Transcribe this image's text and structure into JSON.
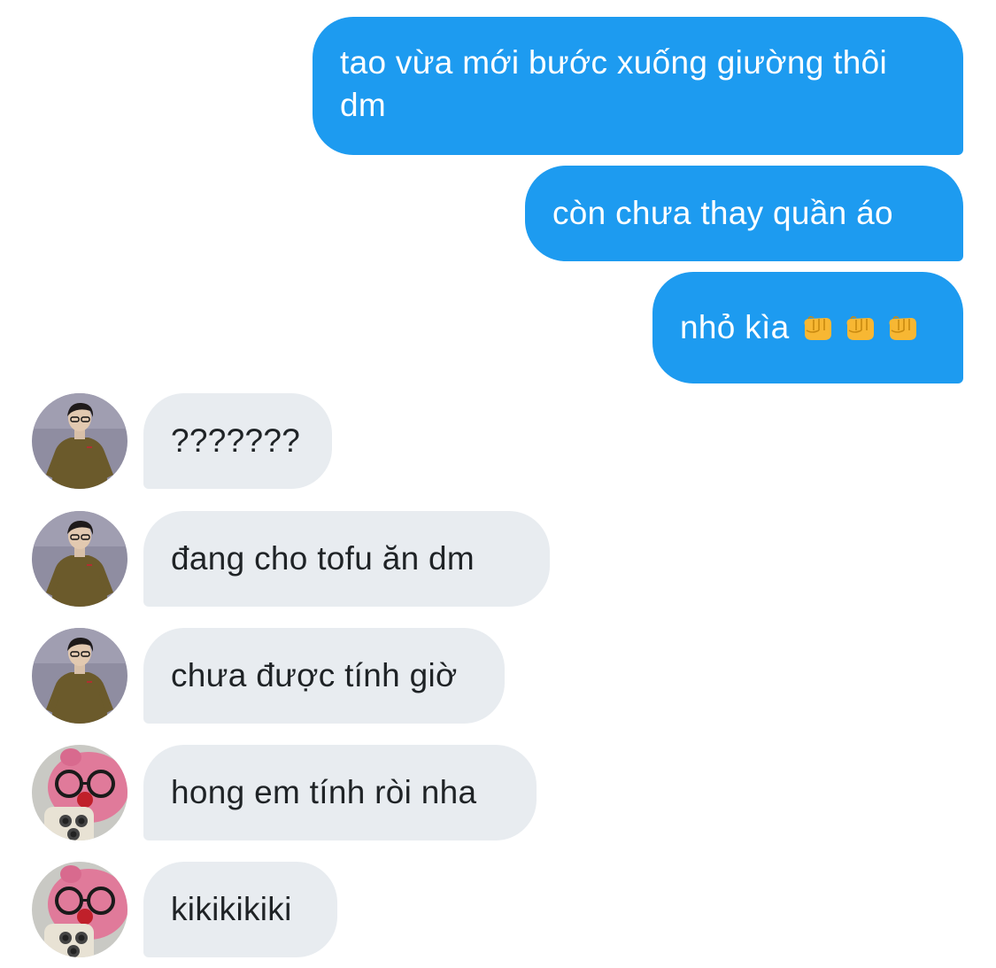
{
  "messages": {
    "sent": [
      {
        "text": "tao vừa mới bước xuống giường thôi dm"
      },
      {
        "text": "còn chưa thay quần áo"
      },
      {
        "text": "nhỏ kìa",
        "emoji": [
          "oncoming-fist-icon",
          "oncoming-fist-icon",
          "oncoming-fist-icon"
        ]
      }
    ],
    "received": [
      {
        "text": "???????",
        "avatar": "person-olive-shirt"
      },
      {
        "text": "đang cho tofu ăn dm",
        "avatar": "person-olive-shirt"
      },
      {
        "text": "chưa được tính giờ",
        "avatar": "person-olive-shirt"
      },
      {
        "text": "hong em tính ròi nha",
        "avatar": "pink-plush-with-glasses"
      },
      {
        "text": "kikikikiki",
        "avatar": "pink-plush-with-glasses"
      }
    ]
  },
  "colors": {
    "sent_bubble": "#1d9bf0",
    "received_bubble": "#e8ecf0",
    "sent_text": "#ffffff",
    "received_text": "#1f2326"
  }
}
